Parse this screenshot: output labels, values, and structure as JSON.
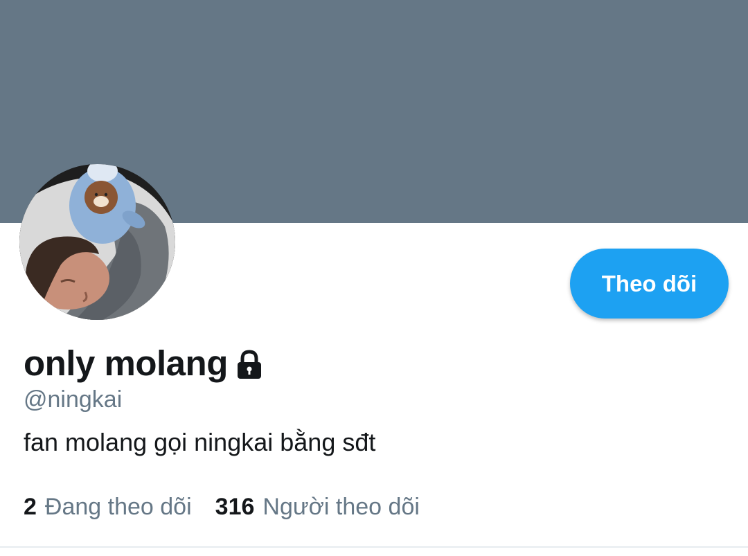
{
  "profile": {
    "display_name": "only molang",
    "handle": "@ningkai",
    "bio": "fan molang gọi ningkai bằng sđt",
    "locked": true,
    "avatar": "profile-photo"
  },
  "actions": {
    "follow_label": "Theo dõi"
  },
  "stats": {
    "following_count": "2",
    "following_label": "Đang theo dõi",
    "followers_count": "316",
    "followers_label": "Người theo dõi"
  },
  "colors": {
    "banner": "#657786",
    "accent": "#1da1f2",
    "text_primary": "#14171a",
    "text_secondary": "#657786"
  },
  "icons": {
    "lock": "lock-icon"
  }
}
